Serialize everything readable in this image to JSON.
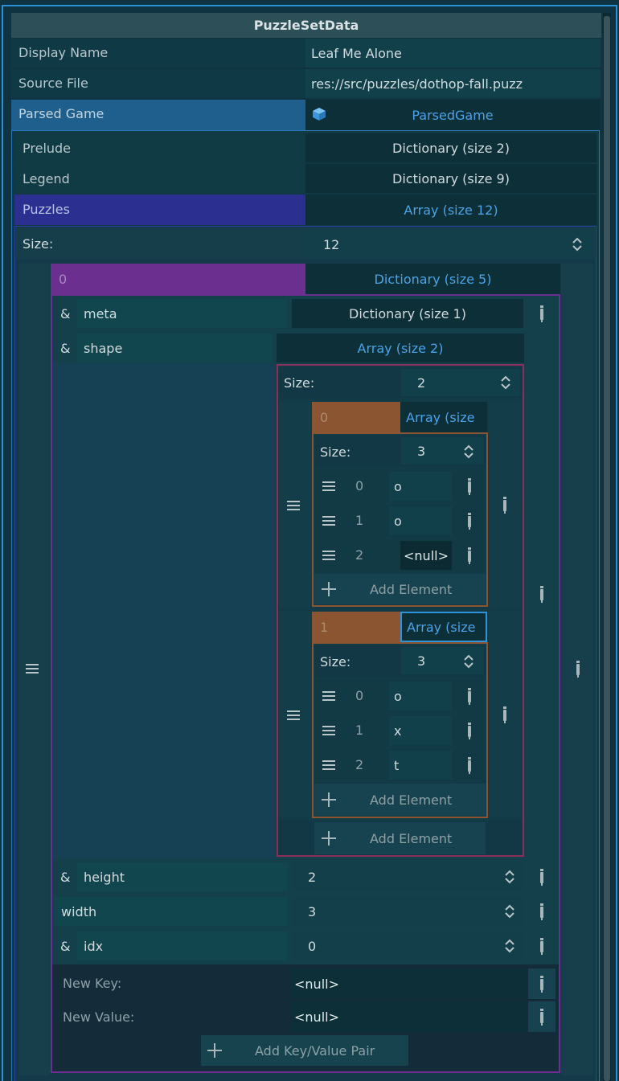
{
  "colors": {
    "outer_border": "#2a91d6",
    "selected_blue": "#1f5f8d",
    "puzzles_purple": "#2b2f8f",
    "dict_magenta": "#6a2f8f",
    "array_orange": "#8a5530",
    "value_blue_text": "#4aa3e8"
  },
  "inspector": {
    "title": "PuzzleSetData",
    "display_name": {
      "label": "Display Name",
      "value": "Leaf Me Alone"
    },
    "source_file": {
      "label": "Source File",
      "value": "res://src/puzzles/dothop-fall.puzz"
    },
    "parsed_game": {
      "label": "Parsed Game",
      "value": "ParsedGame",
      "icon": "cube-icon"
    }
  },
  "parsed_game": {
    "prelude": {
      "label": "Prelude",
      "value": "Dictionary (size 2)"
    },
    "legend": {
      "label": "Legend",
      "value": "Dictionary (size 9)"
    },
    "puzzles": {
      "label": "Puzzles",
      "value": "Array (size 12)"
    }
  },
  "puzzles_array": {
    "size_label": "Size:",
    "size_value": "12",
    "item0": {
      "index": "0",
      "value": "Dictionary (size 5)"
    }
  },
  "dict0": {
    "meta": {
      "prefix": "&",
      "key": "meta",
      "value": "Dictionary (size 1)"
    },
    "shape": {
      "prefix": "&",
      "key": "shape",
      "value": "Array (size 2)"
    },
    "height": {
      "prefix": "&",
      "key": "height",
      "value": "2"
    },
    "width": {
      "key": "width",
      "value": "3"
    },
    "idx": {
      "prefix": "&",
      "key": "idx",
      "value": "0"
    },
    "new_key": {
      "label": "New Key:",
      "value": "<null>"
    },
    "new_value": {
      "label": "New Value:",
      "value": "<null>"
    },
    "add_pair_label": "Add Key/Value Pair"
  },
  "shape_array": {
    "size_label": "Size:",
    "size_value": "2",
    "add_label": "Add Element",
    "row0": {
      "index": "0",
      "value": "Array (size",
      "size_label": "Size:",
      "size_value": "3",
      "items": [
        {
          "index": "0",
          "value": "o"
        },
        {
          "index": "1",
          "value": "o"
        },
        {
          "index": "2",
          "value": "<null>"
        }
      ],
      "add_label": "Add Element"
    },
    "row1": {
      "index": "1",
      "value": "Array (size",
      "size_label": "Size:",
      "size_value": "3",
      "items": [
        {
          "index": "0",
          "value": "o"
        },
        {
          "index": "1",
          "value": "x"
        },
        {
          "index": "2",
          "value": "t"
        }
      ],
      "add_label": "Add Element"
    }
  }
}
